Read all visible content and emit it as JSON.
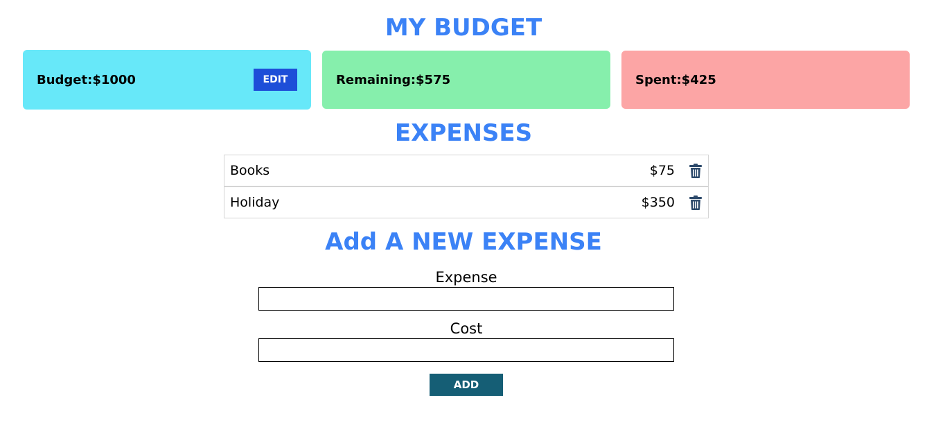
{
  "header": {
    "title": "MY BUDGET"
  },
  "cards": {
    "budget": {
      "text": "Budget:$1000",
      "edit_label": "EDIT",
      "color": "#67e8f9"
    },
    "remaining": {
      "text": "Remaining:$575",
      "color": "#86efac"
    },
    "spent": {
      "text": "Spent:$425",
      "color": "#fca5a5"
    }
  },
  "expenses": {
    "title": "EXPENSES",
    "items": [
      {
        "name": "Books",
        "cost": "$75",
        "icon": "trash-icon"
      },
      {
        "name": "Holiday",
        "cost": "$350",
        "icon": "trash-icon"
      }
    ]
  },
  "form": {
    "title": "Add A NEW EXPENSE",
    "expense_label": "Expense",
    "expense_value": "",
    "cost_label": "Cost",
    "cost_value": "",
    "add_label": "ADD"
  },
  "colors": {
    "accent": "#3b82f6",
    "edit_button": "#1d4ed8",
    "add_button": "#155e75",
    "trash_icon": "#2d4a6b"
  }
}
